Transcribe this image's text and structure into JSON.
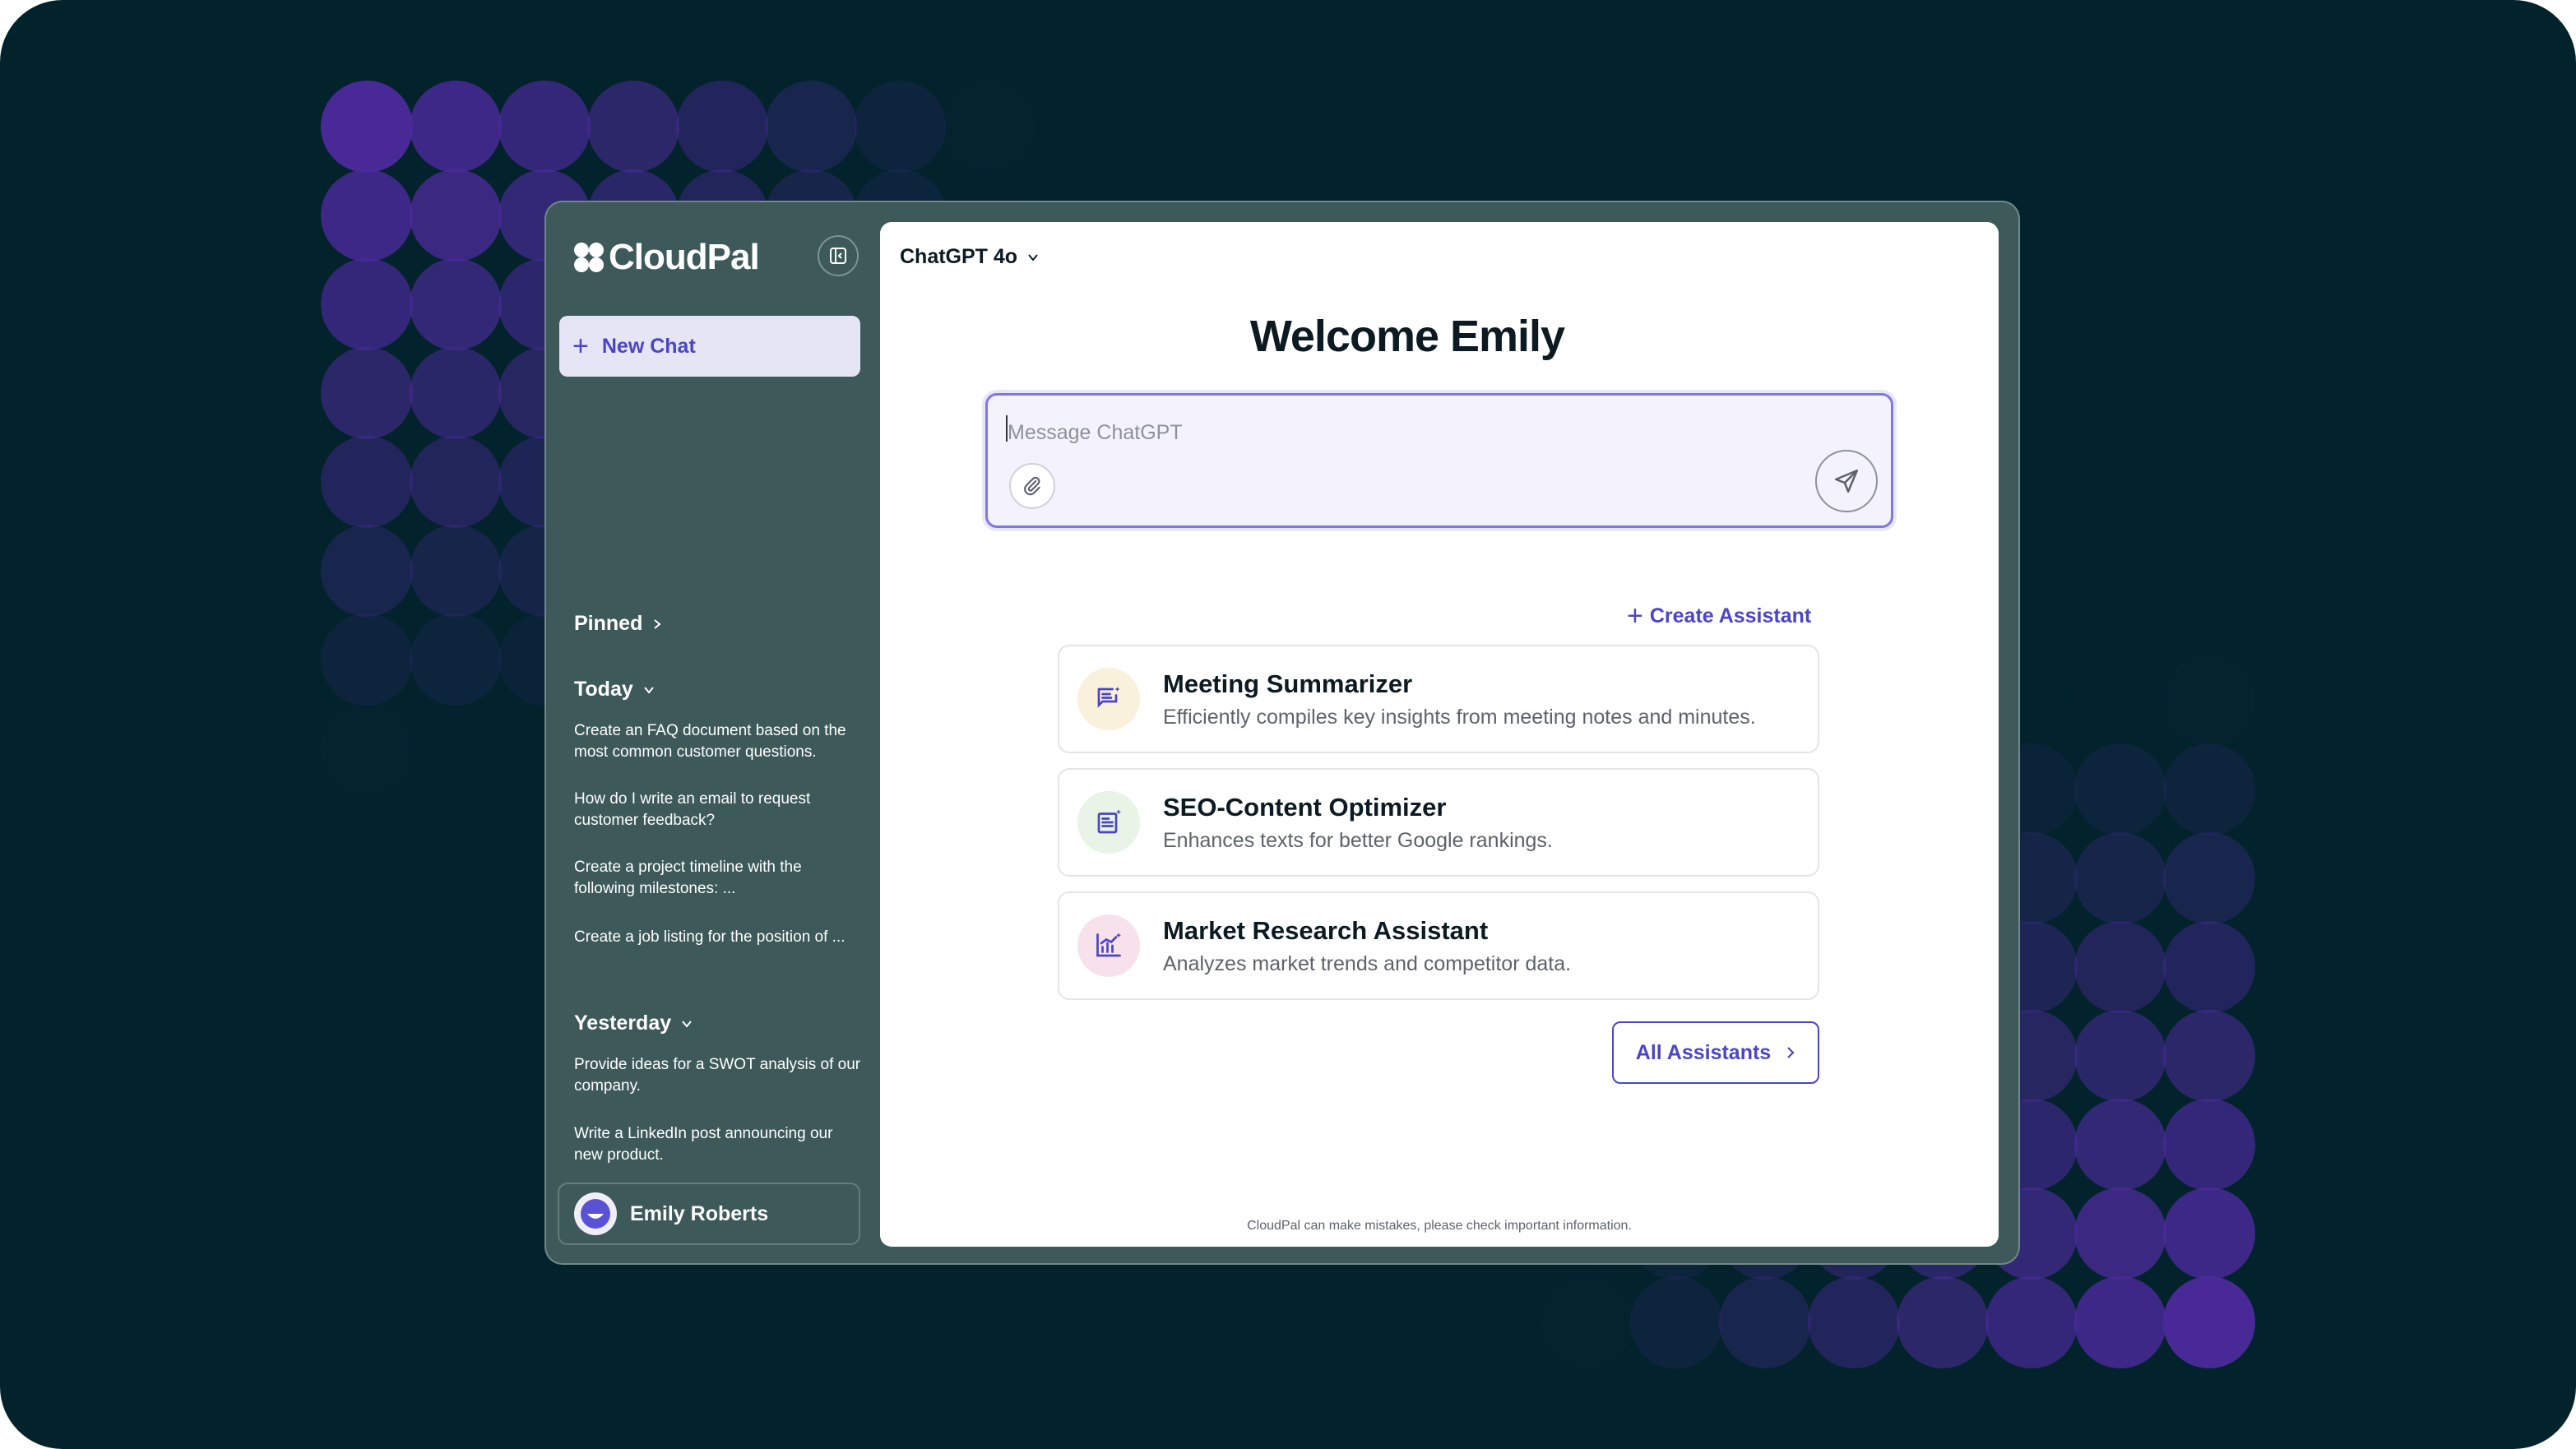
{
  "app": {
    "name": "CloudPal"
  },
  "sidebar": {
    "new_chat_label": "New Chat",
    "pinned_label": "Pinned",
    "today_label": "Today",
    "today_items": [
      "Create an FAQ document based on the most common customer questions.",
      "How do I write an email to request customer feedback?",
      "Create a project timeline with the following milestones: ...",
      "Create a job listing for the position of ..."
    ],
    "yesterday_label": "Yesterday",
    "yesterday_items": [
      "Provide ideas for a SWOT analysis of our company.",
      "Write a LinkedIn post announcing our new product."
    ],
    "user_name": "Emily Roberts"
  },
  "main": {
    "model_label": "ChatGPT 4o",
    "welcome": "Welcome Emily",
    "composer": {
      "placeholder": "Message ChatGPT",
      "value": ""
    },
    "create_assistant_label": "Create Assistant",
    "assistants": [
      {
        "title": "Meeting Summarizer",
        "description": "Efficiently compiles key insights from meeting notes and minutes.",
        "icon": "notes-icon",
        "icon_bg": "#faf1dc"
      },
      {
        "title": "SEO-Content Optimizer",
        "description": "Enhances texts for better Google rankings.",
        "icon": "document-icon",
        "icon_bg": "#e7f4e6"
      },
      {
        "title": "Market Research Assistant",
        "description": "Analyzes market trends and competitor data.",
        "icon": "chart-icon",
        "icon_bg": "#f7e2ec"
      }
    ],
    "all_assistants_label": "All Assistants",
    "disclaimer": "CloudPal can make mistakes, please check important information."
  },
  "colors": {
    "background": "#02232b",
    "window": "#3d5959",
    "accent": "#4b45c6",
    "decor_purple": "#4c2a9c"
  }
}
